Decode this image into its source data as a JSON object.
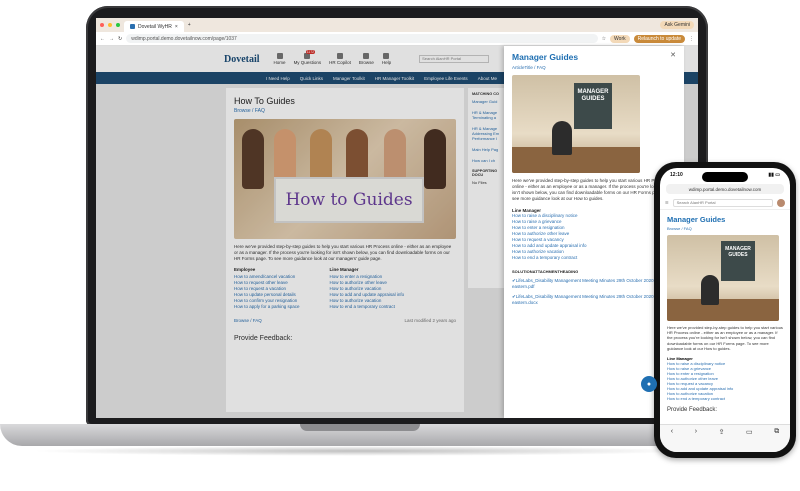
{
  "browser": {
    "tab_title": "Dovetail WyHR",
    "url": "wdimp.portal.demo.dovetailnow.com/page/1037",
    "ask_gemini": "Ask Gemini",
    "profile": "Work",
    "relaunch": "Relaunch to update"
  },
  "site": {
    "logo": "Dovetail",
    "top_nav": [
      "Home",
      "My Questions",
      "HR Copilot",
      "Browse",
      "Help"
    ],
    "questions_badge": "1172",
    "search_placeholder": "Search AlanHR Portal",
    "main_nav": [
      "I Need Help",
      "Quick Links",
      "Manager Toolkit",
      "HR Manager Toolkit",
      "Employee Life Events",
      "About Me"
    ],
    "page_title": "How To Guides",
    "breadcrumb": "Browse / FAQ",
    "hero_text": "How to Guides",
    "intro": "Here we've provided step-by-step guides to help you start various HR Process online - either as an employee or as a manager. If the process you're looking for isn't shown below, you can find downloadable forms on our HR Forms page. To see more guidance look at our managers' guide page.",
    "employee_heading": "Employee",
    "employee_links": [
      "How to amend/cancel vacation",
      "How to request other leave",
      "How to request a vacation",
      "How to update personal details",
      "How to confirm your resignation",
      "How to apply for a parking space"
    ],
    "manager_heading": "Line Manager",
    "manager_links": [
      "How to enter a resignation",
      "How to authorize other leave",
      "How to authorize vacation",
      "How to add and update appraisal info",
      "How to authorize vacation",
      "How to end a temporary contract"
    ],
    "footer_crumb": "Browse / FAQ",
    "last_modified": "Last modified 2 years ago",
    "feedback": "Provide Feedback:",
    "matching_heading": "MATCHING CO",
    "matching_items": [
      "Manager Guid",
      "HR & Manage Terminating a",
      "HR & Manage Addressing Em Performance I",
      "Main Help Pag",
      "How can I ch"
    ],
    "supporting_heading": "SUPPORTING DOCU",
    "no_files": "No Files"
  },
  "panel": {
    "title": "Manager Guides",
    "crumb": "ArticleTitle / FAQ",
    "image_label": "MANAGER GUIDES",
    "intro": "Here we've provided step-by-step guides to help you start various HR Process online - either as an employee or as a manager. If the process you're looking for isn't shown below, you can find downloadable forms on our HR Forms page. To see more guidance look at our How to guides.",
    "line_manager": "Line Manager",
    "links": [
      "How to raise a disciplinary notice",
      "How to raise a grievance",
      "How to enter a resignation",
      "How to authorize other leave",
      "How to request a vacancy",
      "How to add and update appraisal info",
      "How to authorize vacation",
      "How to end a temporary contract"
    ],
    "solution_heading": "SOLUTIONATTACHMENTHEADING",
    "attachments": [
      "LifeLabs_Disability Management Meeting Minutes 29th October 2020 eastern.pdf",
      "LifeLabs_Disability Management Meeting Minutes 29th October 2020 eastern.docx"
    ]
  },
  "phone": {
    "time": "12:10",
    "url": "wdimp.portal.demo.dovetailnow.com",
    "search_placeholder": "Search AlanHR Portal",
    "title": "Manager Guides",
    "crumb": "Browse / FAQ",
    "image_label": "MANAGER GUIDES",
    "intro": "Here we've provided step-by-step guides to help you start various HR Process online - either as an employee or as a manager. If the process you're looking for isn't shown below, you can find downloadable forms on our HR Forms page. To see more guidance look at our How to guides.",
    "line_manager": "Line Manager",
    "links": [
      "How to raise a disciplinary notice",
      "How to raise a grievance",
      "How to enter a resignation",
      "How to authorize other leave",
      "How to request a vacancy",
      "How to add and update appraisal info",
      "How to authorize vacation",
      "How to end a temporary contract"
    ],
    "feedback": "Provide Feedback:"
  }
}
